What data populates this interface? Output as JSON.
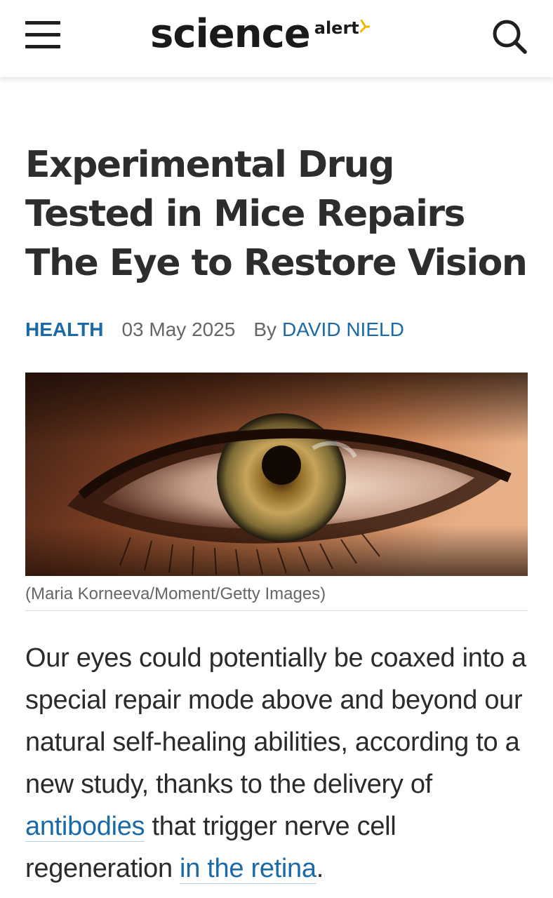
{
  "header": {
    "logo_main": "science",
    "logo_sub": "alert",
    "icons": {
      "menu": "hamburger-menu-icon",
      "search": "search-icon",
      "logo_spark": "spark-icon"
    },
    "colors": {
      "logo_text": "#1a1a1a",
      "spark": "#f2b705"
    }
  },
  "article": {
    "title": "Experimental Drug Tested in Mice Repairs The Eye to Restore Vision",
    "category": "HEALTH",
    "date": "03 May 2025",
    "by_label": "By",
    "author": "DAVID NIELD",
    "image_caption": "(Maria Korneeva/Moment/Getty Images)",
    "body": {
      "text_1": "Our eyes could potentially be coaxed into a special repair mode above and beyond our natural self-healing abilities, according to a new study, thanks to the delivery of ",
      "link_1": "antibodies",
      "text_2": " that trigger nerve cell regeneration ",
      "link_2": "in the retina",
      "text_3": "."
    },
    "colors": {
      "link": "#1a6aa8",
      "title": "#2d2d2d",
      "muted": "#666666"
    }
  }
}
